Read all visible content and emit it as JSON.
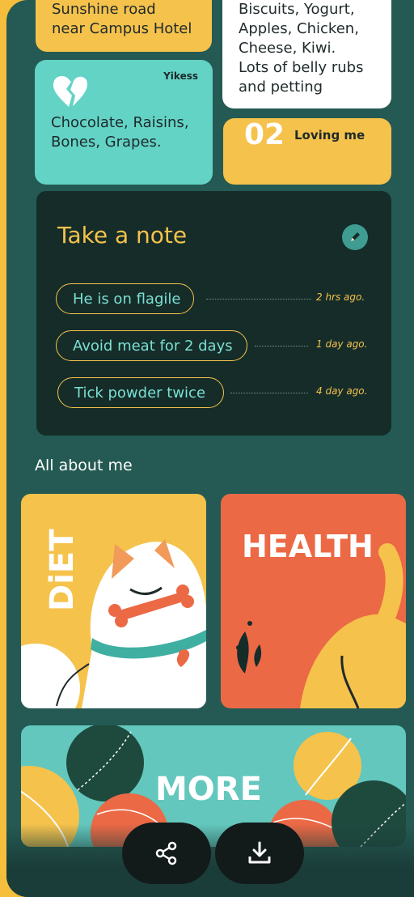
{
  "cards": {
    "location": {
      "text_lines": [
        "Sunshine road",
        "near Campus Hotel"
      ]
    },
    "favorites": {
      "text_lines": [
        "Biscuits, Yogurt,",
        "Apples, Chicken,",
        "Cheese, Kiwi.",
        "Lots of belly rubs",
        "and petting"
      ]
    },
    "dislikes": {
      "badge": "Yikess",
      "text_lines": [
        "Chocolate, Raisins,",
        "Bones, Grapes."
      ]
    },
    "loving": {
      "number": "02",
      "label": "Loving me"
    }
  },
  "note": {
    "title": "Take a note",
    "items": [
      {
        "text": "He is on flagile",
        "time": "2 hrs ago."
      },
      {
        "text": "Avoid meat for 2 days",
        "time": "1 day ago."
      },
      {
        "text": "Tick powder twice",
        "time": "4 day ago."
      }
    ]
  },
  "section_title": "All about me",
  "tiles": [
    {
      "label": "DiET"
    },
    {
      "label": "HEALTH"
    },
    {
      "label": "MORE"
    }
  ],
  "icons": {
    "share": "share-icon",
    "download": "download-icon",
    "pencil": "pencil-icon",
    "broken_heart": "broken-heart-icon"
  },
  "colors": {
    "background": "#245A53",
    "accent_yellow": "#F5C24C",
    "accent_teal": "#63D3C6",
    "accent_orange": "#EC6946",
    "dark_panel": "#152C29"
  }
}
